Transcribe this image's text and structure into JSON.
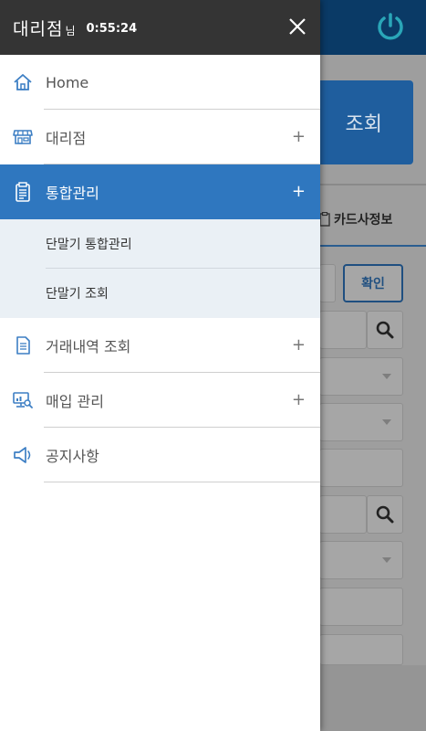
{
  "drawer": {
    "agency_name": "대리점",
    "honorific": "님",
    "timer": "0:55:24",
    "close_icon": "close-icon"
  },
  "menu": {
    "items": [
      {
        "label": "Home",
        "icon": "home-icon",
        "expandable": false
      },
      {
        "label": "대리점",
        "icon": "store-icon",
        "expandable": true
      },
      {
        "label": "통합관리",
        "icon": "terminal-icon",
        "expandable": true,
        "active": true
      },
      {
        "label": "거래내역 조회",
        "icon": "document-icon",
        "expandable": true
      },
      {
        "label": "매입 관리",
        "icon": "monitor-search-icon",
        "expandable": true
      },
      {
        "label": "공지사항",
        "icon": "megaphone-icon",
        "expandable": false
      }
    ],
    "expand_symbol": "+",
    "submenu_items": [
      {
        "label": "단말기 통합관리"
      },
      {
        "label": "단말기 조회"
      }
    ]
  },
  "background": {
    "query_button": "조회",
    "tab_label": "카드사정보",
    "confirm_button": "확인"
  },
  "colors": {
    "header_bg": "#343434",
    "active_bg": "#2f77bf",
    "submenu_bg": "#eaf0f5",
    "icon_blue": "#3d7fc4"
  }
}
